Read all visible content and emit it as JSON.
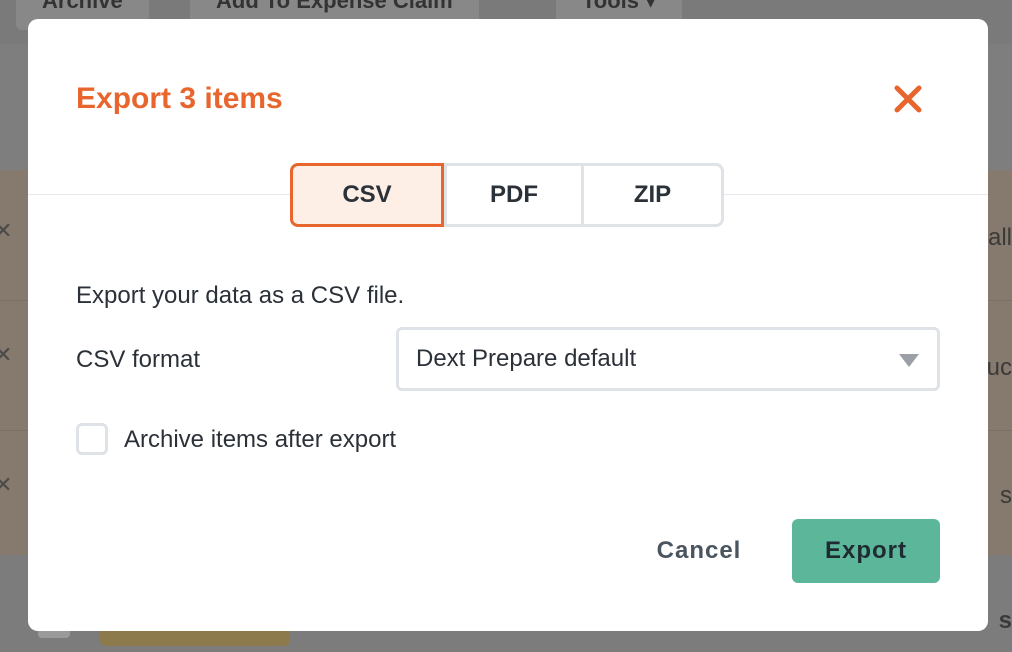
{
  "background": {
    "toolbar_buttons": [
      "Archive",
      "Add To Expense Claim",
      "Tools ▾"
    ],
    "row_fragments": [
      "all",
      "uc",
      "s",
      "s"
    ]
  },
  "modal": {
    "title": "Export 3 items",
    "close_icon": "close-icon",
    "tabs": [
      {
        "label": "CSV",
        "active": true
      },
      {
        "label": "PDF",
        "active": false
      },
      {
        "label": "ZIP",
        "active": false
      }
    ],
    "description": "Export your data as a CSV file.",
    "format_label": "CSV format",
    "format_select": {
      "value": "Dext Prepare default"
    },
    "archive_checkbox": {
      "label": "Archive items after export",
      "checked": false
    },
    "cancel_label": "Cancel",
    "export_label": "Export"
  },
  "colors": {
    "accent": "#e8662e",
    "primary_button": "#5cb79a",
    "active_tab_bg": "#fdefe6",
    "text": "#2b3138",
    "border": "#dfe2e6"
  }
}
